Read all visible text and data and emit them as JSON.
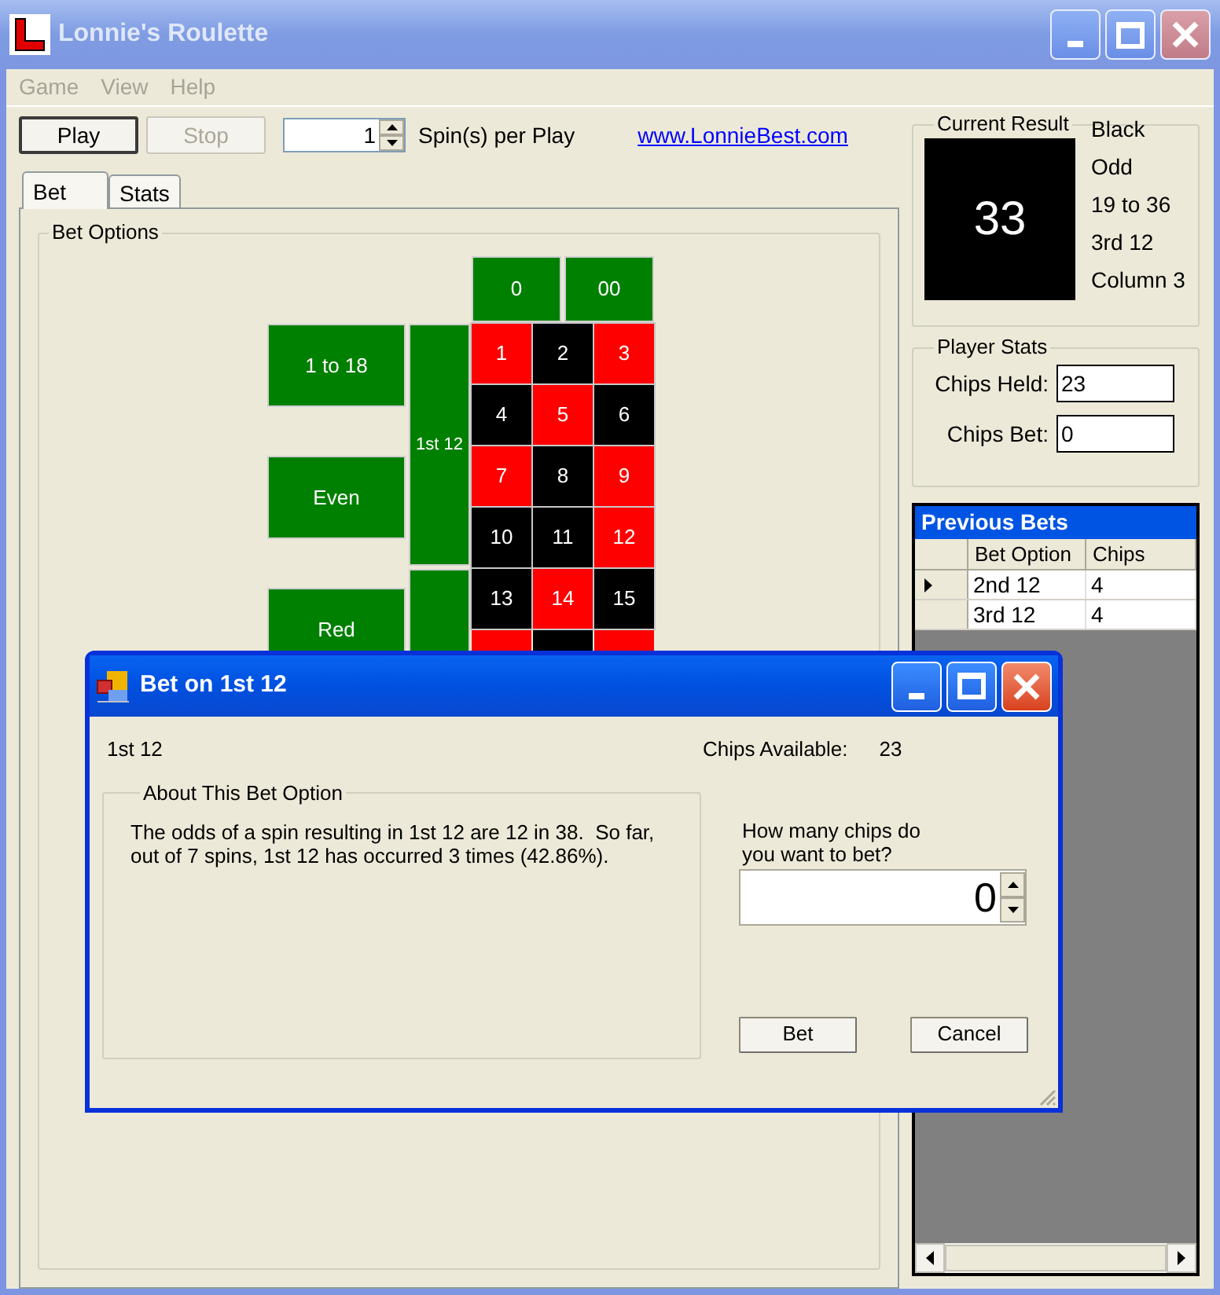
{
  "window": {
    "title": "Lonnie's Roulette"
  },
  "menu": [
    {
      "label": "Game",
      "disabled": true
    },
    {
      "label": "View",
      "disabled": true
    },
    {
      "label": "Help",
      "disabled": true
    }
  ],
  "toolbar": {
    "buttons": [
      {
        "label": "Play",
        "disabled": false
      },
      {
        "label": "Stop",
        "disabled": true
      }
    ],
    "spins": {
      "value": "1"
    },
    "spins_label": "Spin(s) per Play",
    "link": "www.LonnieBest.com"
  },
  "tabs": [
    {
      "label": "Bet",
      "selected": true
    },
    {
      "label": "Stats",
      "selected": false
    }
  ],
  "bet_options": {
    "title": "Bet Options",
    "zeros": [
      "0",
      "00"
    ],
    "outside": [
      "1 to 18",
      "Even",
      "Red"
    ],
    "dozens": [
      "1st 12"
    ],
    "numbers": [
      {
        "label": "1",
        "color": "#ff0000"
      },
      {
        "label": "2",
        "color": "#000000"
      },
      {
        "label": "3",
        "color": "#ff0000"
      },
      {
        "label": "4",
        "color": "#000000"
      },
      {
        "label": "5",
        "color": "#ff0000"
      },
      {
        "label": "6",
        "color": "#000000"
      },
      {
        "label": "7",
        "color": "#ff0000"
      },
      {
        "label": "8",
        "color": "#000000"
      },
      {
        "label": "9",
        "color": "#ff0000"
      },
      {
        "label": "10",
        "color": "#000000"
      },
      {
        "label": "11",
        "color": "#000000"
      },
      {
        "label": "12",
        "color": "#ff0000"
      },
      {
        "label": "13",
        "color": "#000000"
      },
      {
        "label": "14",
        "color": "#ff0000"
      },
      {
        "label": "15",
        "color": "#000000"
      }
    ],
    "partial_row": [
      {
        "color": "#ff0000"
      },
      {
        "color": "#000000"
      },
      {
        "color": "#ff0000"
      }
    ]
  },
  "current_result": {
    "title": "Current Result",
    "number": "33",
    "color": "#000000",
    "attributes": [
      "Black",
      "Odd",
      "19 to 36",
      "3rd 12",
      "Column 3"
    ]
  },
  "player_stats": {
    "title": "Player Stats",
    "fields": [
      {
        "label": "Chips Held:",
        "value": "23"
      },
      {
        "label": "Chips Bet:",
        "value": "0"
      }
    ]
  },
  "previous_bets": {
    "title": "Previous Bets",
    "columns": [
      "Bet Option",
      "Chips"
    ],
    "rows": [
      {
        "cells": [
          "2nd 12",
          "4"
        ],
        "selected": true
      },
      {
        "cells": [
          "3rd 12",
          "4"
        ],
        "selected": false
      }
    ]
  },
  "dialog": {
    "title": "Bet on 1st 12",
    "bet_name": "1st 12",
    "chips_available_label": "Chips Available:",
    "chips_available": "23",
    "group_title": "About This Bet Option",
    "description": "The odds of a spin resulting in 1st 12 are 12 in 38.  So far, out of 7 spins, 1st 12 has occurred 3 times (42.86%).",
    "prompt": "How many chips do you want to bet?",
    "value": "0",
    "buttons": [
      "Bet",
      "Cancel"
    ]
  }
}
